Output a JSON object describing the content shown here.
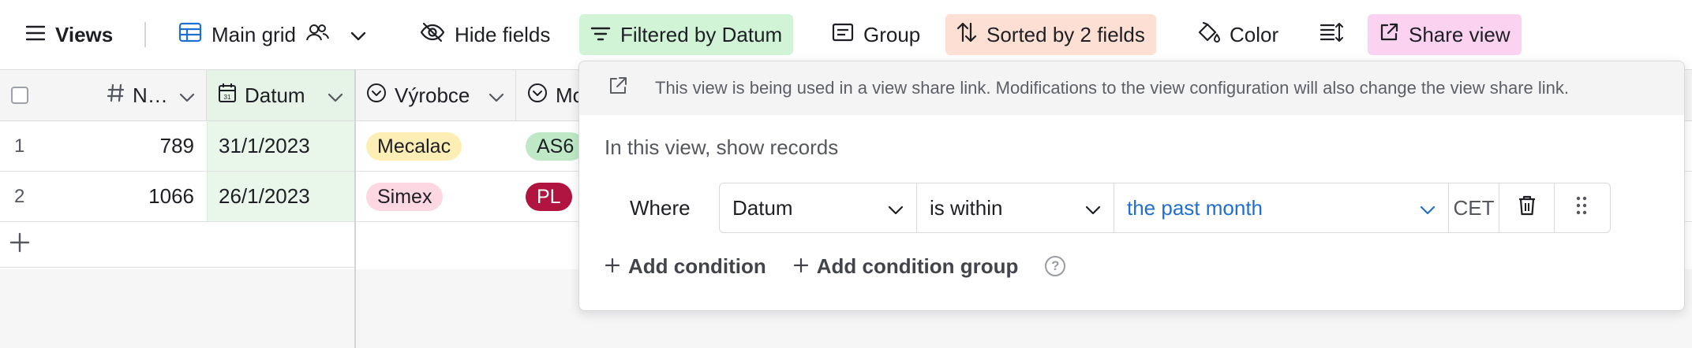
{
  "toolbar": {
    "views_label": "Views",
    "view_name": "Main grid",
    "hide_fields": "Hide fields",
    "filter": "Filtered by Datum",
    "group": "Group",
    "sort": "Sorted by 2 fields",
    "color": "Color",
    "share_view": "Share view",
    "colors": {
      "filter_bg": "#d1f3d6",
      "sort_bg": "#fde0d3",
      "share_bg": "#fbd3f0"
    }
  },
  "grid": {
    "columns": [
      {
        "label": "N…",
        "icon": "hash-icon"
      },
      {
        "label": "Datum",
        "icon": "calendar-icon"
      },
      {
        "label": "Výrobce",
        "icon": "single-select-icon"
      },
      {
        "label": "Mo",
        "icon": "single-select-icon"
      }
    ],
    "rows": [
      {
        "row_number": "1",
        "number": "789",
        "date": "31/1/2023",
        "manufacturer": "Mecalac",
        "model": "AS6"
      },
      {
        "row_number": "2",
        "number": "1066",
        "date": "26/1/2023",
        "manufacturer": "Simex",
        "model": "PL"
      }
    ]
  },
  "filter_popover": {
    "share_notice": "This view is being used in a view share link. Modifications to the view configuration will also change the view share link.",
    "intro": "In this view, show records",
    "conditions": [
      {
        "prefix": "Where",
        "field": "Datum",
        "operator": "is within",
        "value": "the past month",
        "timezone": "CET"
      }
    ],
    "add_condition": "Add condition",
    "add_condition_group": "Add condition group",
    "help_symbol": "?"
  }
}
